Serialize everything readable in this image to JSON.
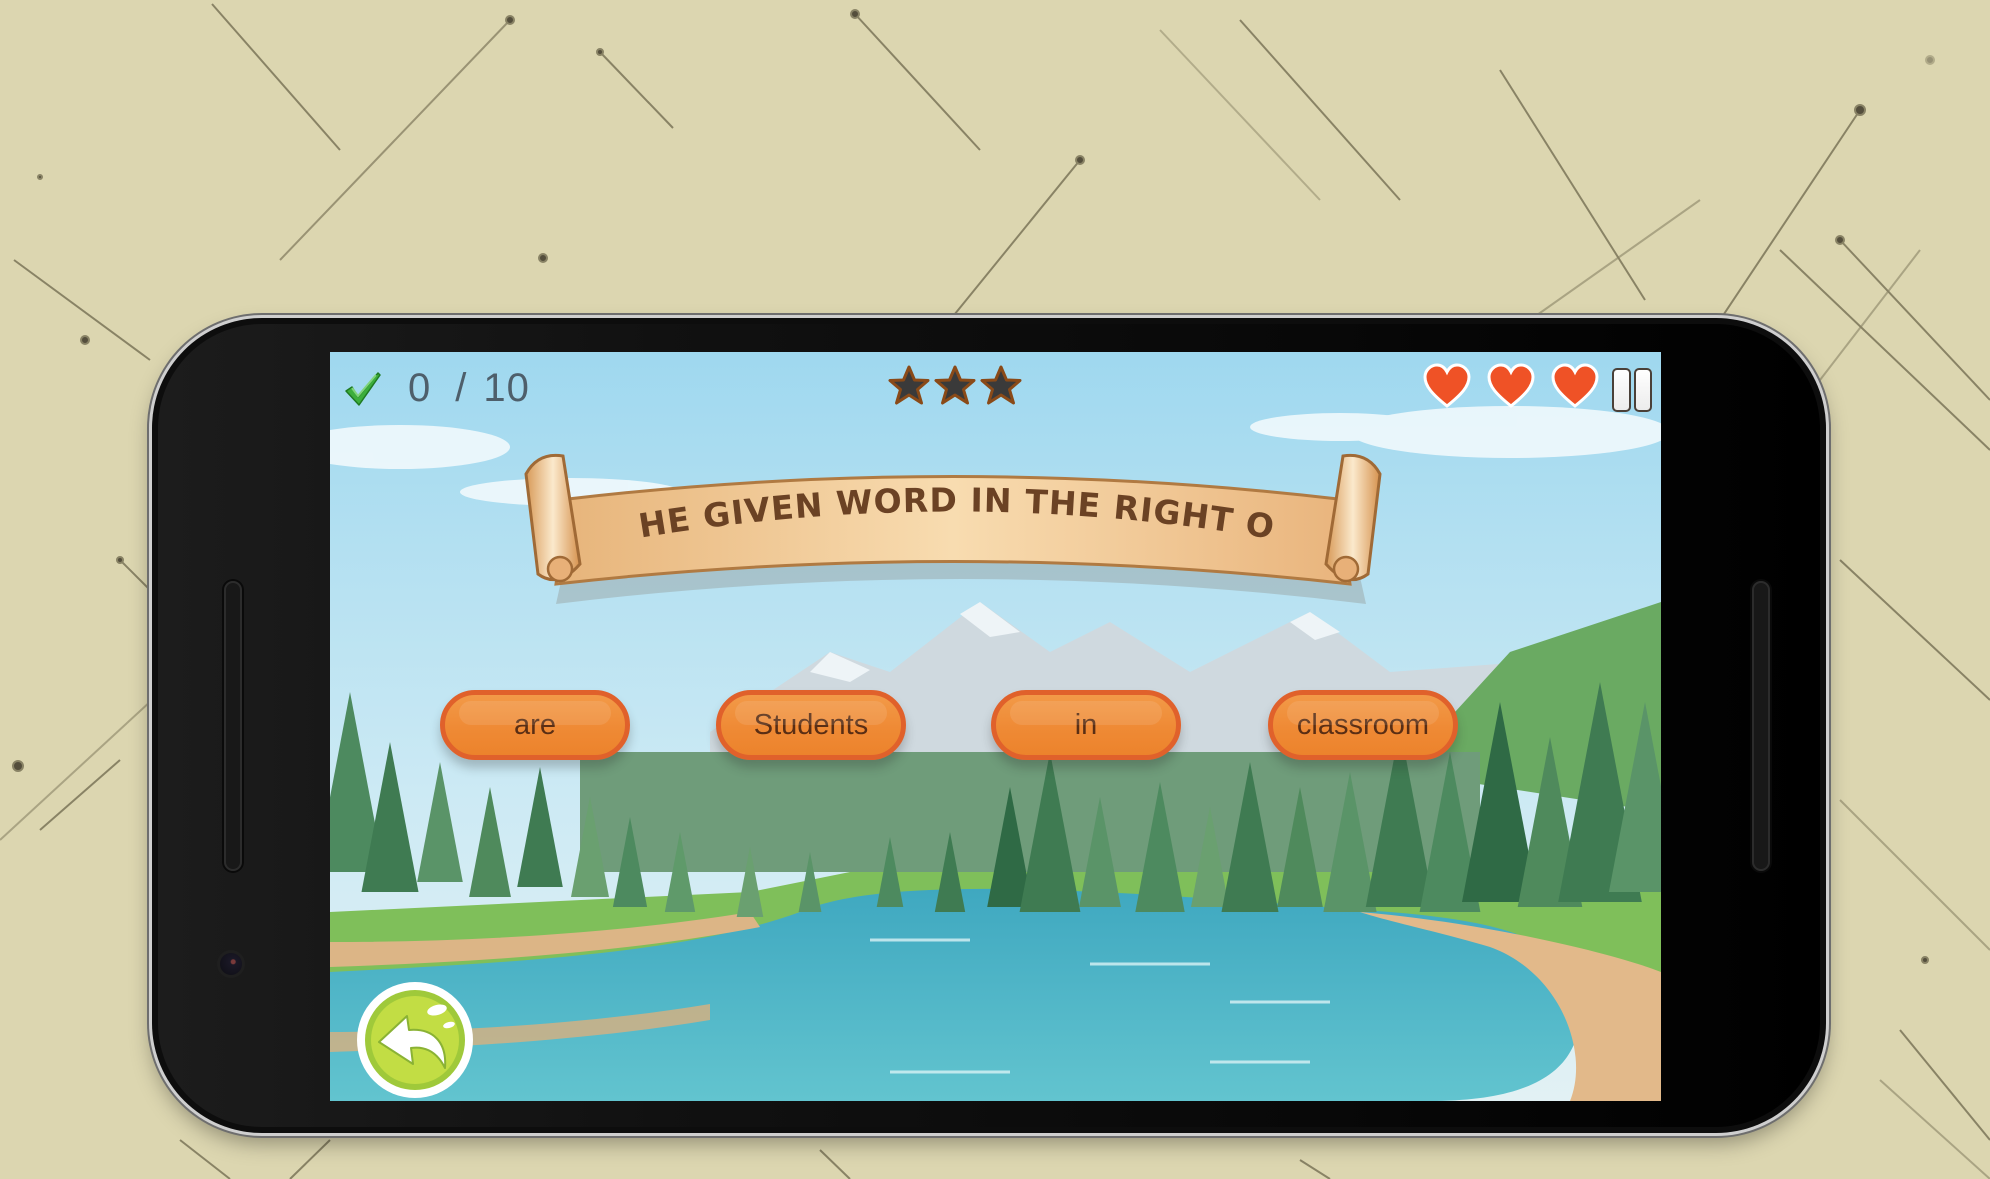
{
  "hud": {
    "correct_count": "0",
    "separator": "/",
    "total_count": "10",
    "check_icon": "check-icon",
    "stars": {
      "earned": 3,
      "max": 3,
      "icon": "star-icon"
    },
    "lives": {
      "remaining": 3,
      "max": 3,
      "icon": "heart-icon"
    },
    "pause_icon": "pause-icon"
  },
  "banner": {
    "instruction": "PUT THE GIVEN WORD IN THE RIGHT ORDER"
  },
  "words": [
    {
      "label": "are"
    },
    {
      "label": "Students"
    },
    {
      "label": "in"
    },
    {
      "label": "classroom"
    }
  ],
  "back_button": {
    "icon": "back-arrow-icon"
  },
  "colors": {
    "tile_fill": "#ef8a35",
    "tile_border": "#e0612b",
    "tile_text": "#5a2e14",
    "heart": "#ef5226",
    "star": "#3a3a3a",
    "star_outline": "#8a4a18",
    "check": "#3cae3c",
    "back_button": "#b8d83c",
    "background": "#dcd6b0",
    "banner_text": "#6b4224"
  }
}
